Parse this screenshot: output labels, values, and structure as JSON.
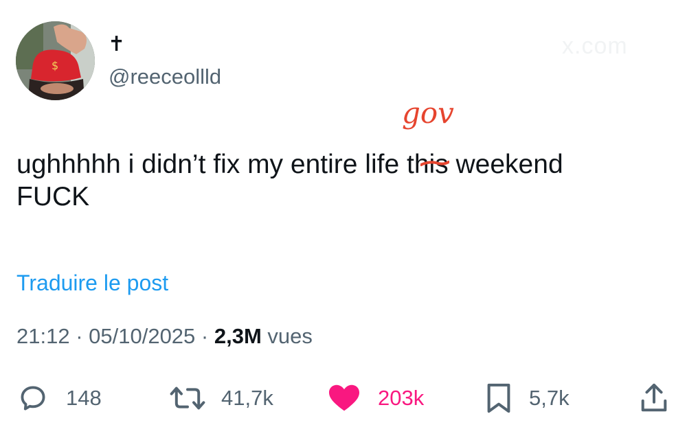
{
  "author": {
    "display_name": "✝",
    "handle": "@reeceollld"
  },
  "watermark": "x.com",
  "tweet": {
    "text_before": "ughhhhh i didn’t fix my entire ",
    "struck_word": "life",
    "correction": "gov",
    "text_after": " this weekend",
    "line2": "FUCK"
  },
  "translate_label": "Traduire le post",
  "meta": {
    "time": "21:12",
    "sep1": " · ",
    "date": "05/10/2025",
    "sep2": " · ",
    "views_count": "2,3M",
    "views_label": " vues"
  },
  "actions": {
    "replies": "148",
    "reposts": "41,7k",
    "likes": "203k",
    "bookmarks": "5,7k"
  },
  "colors": {
    "accent": "#1d9bf0",
    "like": "#f91880",
    "correction": "#e6452f",
    "muted": "#536471"
  },
  "icons": {
    "reply": "reply-bubble-icon",
    "repost": "repost-arrows-icon",
    "like": "heart-filled-icon",
    "bookmark": "bookmark-icon",
    "share": "share-upload-icon"
  }
}
